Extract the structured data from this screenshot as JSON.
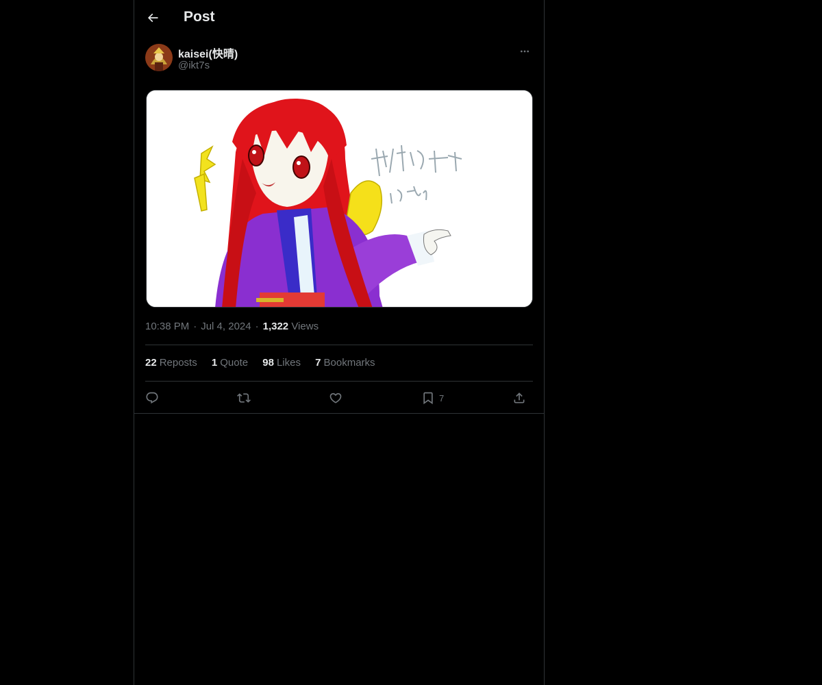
{
  "header": {
    "title": "Post"
  },
  "author": {
    "name": "kaisei(快晴)",
    "handle": "@ikt7s"
  },
  "media": {
    "signature_text": "桂花 小兎姫 ikt7s"
  },
  "meta": {
    "time": "10:38 PM",
    "date": "Jul 4, 2024",
    "views_count": "1,322",
    "views_label": "Views",
    "separator": "·"
  },
  "stats": [
    {
      "count": "22",
      "label": "Reposts"
    },
    {
      "count": "1",
      "label": "Quote"
    },
    {
      "count": "98",
      "label": "Likes"
    },
    {
      "count": "7",
      "label": "Bookmarks"
    }
  ],
  "actions": {
    "bookmark_count": "7"
  },
  "icons": [
    "back-arrow-icon",
    "more-icon",
    "reply-icon",
    "repost-icon",
    "like-icon",
    "bookmark-icon",
    "share-icon"
  ]
}
